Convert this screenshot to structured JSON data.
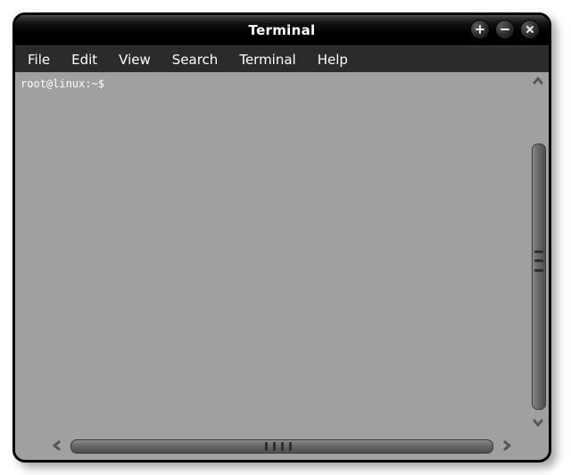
{
  "window": {
    "title": "Terminal"
  },
  "menus": {
    "file": "File",
    "edit": "Edit",
    "view": "View",
    "search": "Search",
    "terminal": "Terminal",
    "help": "Help"
  },
  "terminal": {
    "prompt": "root@linux:~$"
  }
}
